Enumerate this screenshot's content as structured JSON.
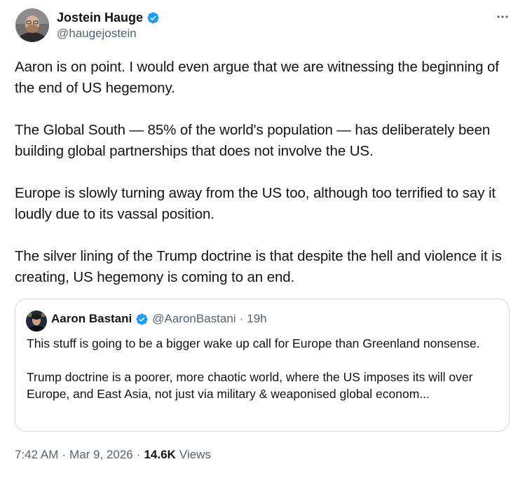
{
  "author": {
    "display_name": "Jostein Hauge",
    "handle": "@haugejostein",
    "verified_icon": "verified-badge-icon",
    "accent_color": "#1d9bf0"
  },
  "tweet": {
    "text": "Aaron is on point. I would even argue that we are witnessing the beginning of the end of US hegemony.\n\nThe Global South — 85% of the world's population — has deliberately been building global partnerships that does not involve the US.\n\nEurope is slowly turning away from the US too, although too terrified to say it loudly due to its vassal position.\n\nThe silver lining of the Trump doctrine is that despite the hell and violence it is creating, US hegemony is coming to an end."
  },
  "quote": {
    "display_name": "Aaron Bastani",
    "handle": "@AaronBastani",
    "separator": "·",
    "time": "19h",
    "text": "This stuff is going to be a bigger wake up call for Europe than Greenland nonsense.\n\nTrump doctrine is a poorer, more chaotic world, where the US imposes its will over Europe, and East Asia, not just via military & weaponised global econom..."
  },
  "meta": {
    "time": "7:42 AM",
    "sep1": "·",
    "date": "Mar 9, 2026",
    "sep2": "·",
    "views_count": "14.6K",
    "views_label": "Views"
  },
  "icons": {
    "more": "more-options-icon"
  }
}
